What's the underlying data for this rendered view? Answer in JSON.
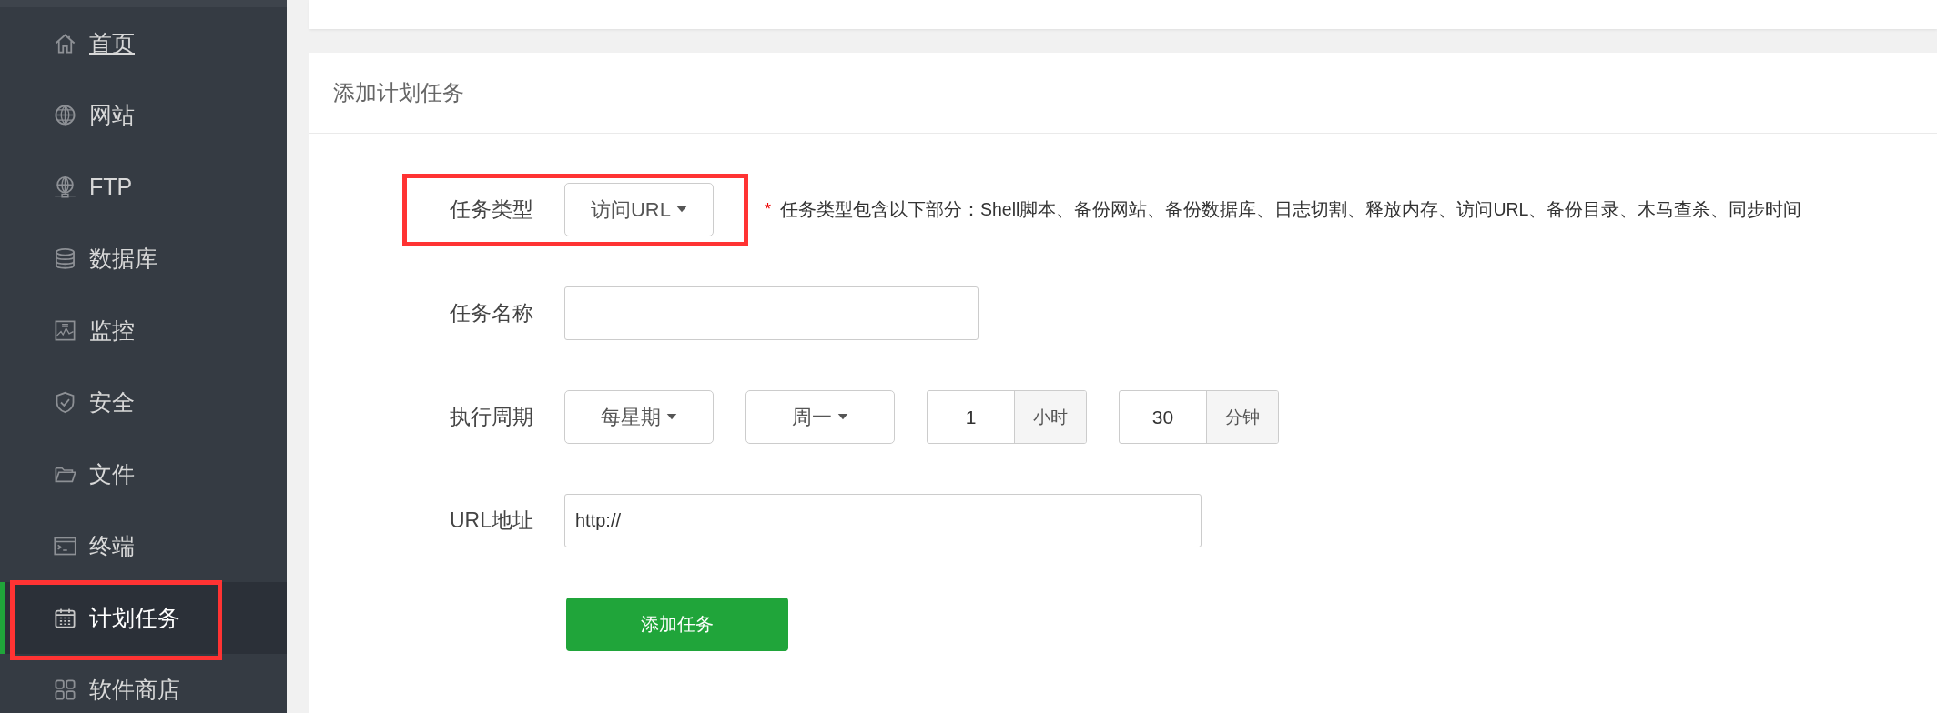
{
  "sidebar": {
    "items": [
      {
        "label": "首页",
        "selected": false,
        "underlined": true,
        "highlighted": false
      },
      {
        "label": "网站",
        "selected": false,
        "underlined": false,
        "highlighted": false
      },
      {
        "label": "FTP",
        "selected": false,
        "underlined": false,
        "highlighted": false
      },
      {
        "label": "数据库",
        "selected": false,
        "underlined": false,
        "highlighted": false
      },
      {
        "label": "监控",
        "selected": false,
        "underlined": false,
        "highlighted": false
      },
      {
        "label": "安全",
        "selected": false,
        "underlined": false,
        "highlighted": false
      },
      {
        "label": "文件",
        "selected": false,
        "underlined": false,
        "highlighted": false
      },
      {
        "label": "终端",
        "selected": false,
        "underlined": false,
        "highlighted": false
      },
      {
        "label": "计划任务",
        "selected": true,
        "underlined": false,
        "highlighted": true
      },
      {
        "label": "软件商店",
        "selected": false,
        "underlined": false,
        "highlighted": false
      }
    ]
  },
  "form": {
    "title": "添加计划任务",
    "rows": [
      {
        "kind": "select",
        "label": "任务类型",
        "highlighted": true,
        "value": "访问URL",
        "required_mark": "*",
        "hint": "任务类型包含以下部分：Shell脚本、备份网站、备份数据库、日志切割、释放内存、访问URL、备份目录、木马查杀、同步时间"
      },
      {
        "kind": "input",
        "label": "任务名称",
        "highlighted": false
      },
      {
        "kind": "group",
        "label": "执行周期",
        "highlighted": false,
        "controls": [
          {
            "kind": "select",
            "value": "每星期"
          },
          {
            "kind": "select",
            "value": "周一"
          },
          {
            "kind": "unit_input",
            "value": "1",
            "unit": "小时"
          },
          {
            "kind": "unit_input",
            "value": "30",
            "unit": "分钟"
          }
        ]
      },
      {
        "kind": "input",
        "label": "URL地址",
        "highlighted": false,
        "value": "http://"
      }
    ],
    "submit_button": "添加任务"
  }
}
